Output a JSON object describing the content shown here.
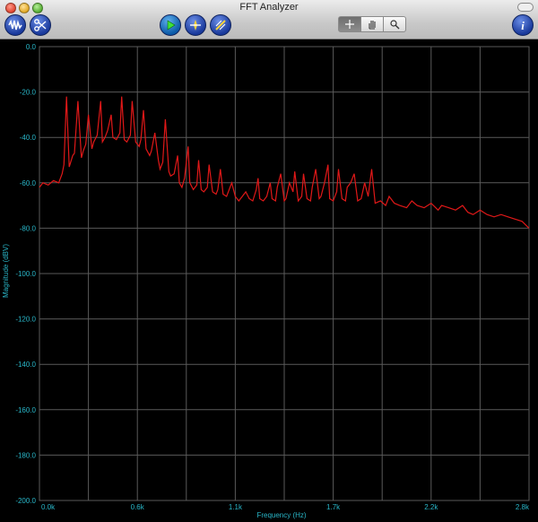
{
  "window": {
    "title": "FFT Analyzer"
  },
  "toolbar": {
    "icons": [
      "waveform-icon",
      "scissors-icon",
      "play-icon",
      "crosshair-target-icon",
      "sweep-icon",
      "info-icon"
    ],
    "tools": [
      "crosshair-icon",
      "hand-icon",
      "zoom-icon"
    ],
    "accent": "#1a3a9c"
  },
  "chart_data": {
    "type": "line",
    "xlabel": "Frequency (Hz)",
    "ylabel": "Magnitude (dBV)",
    "xlim": [
      0,
      2.8
    ],
    "ylim": [
      -200,
      0
    ],
    "x_tick_labels": [
      "0.0k",
      "0.6k",
      "1.1k",
      "1.7k",
      "2.2k",
      "2.8k"
    ],
    "y_tick_labels": [
      "0.0",
      "-20.0",
      "-40.0",
      "-60.0",
      "-80.0",
      "-100.0",
      "-120.0",
      "-140.0",
      "-160.0",
      "-180.0",
      "-200.0"
    ],
    "x_ticks": [
      0,
      0.56,
      1.12,
      1.68,
      2.24,
      2.8
    ],
    "y_ticks": [
      0,
      -20,
      -40,
      -60,
      -80,
      -100,
      -120,
      -140,
      -160,
      -180,
      -200
    ],
    "grid": true,
    "line_color": "#e01818",
    "grid_color": "#5a5a5a",
    "series": [
      {
        "x": [
          0.0,
          0.02,
          0.05,
          0.08,
          0.11,
          0.13,
          0.14,
          0.155,
          0.17,
          0.19,
          0.2,
          0.22,
          0.24,
          0.25,
          0.265,
          0.28,
          0.3,
          0.31,
          0.33,
          0.35,
          0.36,
          0.375,
          0.39,
          0.41,
          0.42,
          0.44,
          0.46,
          0.47,
          0.485,
          0.5,
          0.52,
          0.53,
          0.55,
          0.57,
          0.58,
          0.595,
          0.61,
          0.63,
          0.64,
          0.66,
          0.68,
          0.69,
          0.705,
          0.72,
          0.74,
          0.75,
          0.77,
          0.79,
          0.8,
          0.815,
          0.83,
          0.85,
          0.86,
          0.88,
          0.9,
          0.91,
          0.925,
          0.94,
          0.96,
          0.97,
          0.99,
          1.01,
          1.02,
          1.035,
          1.05,
          1.07,
          1.08,
          1.1,
          1.12,
          1.14,
          1.16,
          1.18,
          1.2,
          1.22,
          1.24,
          1.25,
          1.26,
          1.28,
          1.3,
          1.32,
          1.33,
          1.35,
          1.36,
          1.38,
          1.4,
          1.41,
          1.43,
          1.45,
          1.46,
          1.48,
          1.5,
          1.51,
          1.53,
          1.55,
          1.56,
          1.58,
          1.6,
          1.61,
          1.63,
          1.65,
          1.66,
          1.68,
          1.7,
          1.71,
          1.73,
          1.75,
          1.76,
          1.78,
          1.8,
          1.82,
          1.84,
          1.86,
          1.88,
          1.9,
          1.92,
          1.95,
          1.98,
          2.0,
          2.03,
          2.06,
          2.1,
          2.13,
          2.16,
          2.2,
          2.24,
          2.28,
          2.3,
          2.34,
          2.38,
          2.42,
          2.45,
          2.48,
          2.52,
          2.56,
          2.6,
          2.64,
          2.68,
          2.72,
          2.76,
          2.8
        ],
        "y": [
          -62,
          -60,
          -61,
          -59,
          -60,
          -56,
          -52,
          -22,
          -53,
          -48,
          -47,
          -24,
          -49,
          -46,
          -43,
          -30,
          -45,
          -42,
          -39,
          -24,
          -42,
          -40,
          -37,
          -30,
          -40,
          -41,
          -38,
          -22,
          -41,
          -42,
          -39,
          -24,
          -42,
          -44,
          -41,
          -28,
          -45,
          -48,
          -46,
          -38,
          -50,
          -54,
          -51,
          -32,
          -55,
          -57,
          -56,
          -48,
          -60,
          -62,
          -58,
          -44,
          -60,
          -63,
          -61,
          -50,
          -63,
          -64,
          -62,
          -52,
          -64,
          -65,
          -63,
          -54,
          -65,
          -66,
          -64,
          -60,
          -66,
          -68,
          -66,
          -64,
          -67,
          -68,
          -63,
          -58,
          -67,
          -68,
          -66,
          -60,
          -67,
          -68,
          -62,
          -56,
          -68,
          -67,
          -60,
          -64,
          -55,
          -68,
          -66,
          -56,
          -67,
          -68,
          -62,
          -54,
          -67,
          -66,
          -60,
          -52,
          -67,
          -68,
          -64,
          -54,
          -67,
          -68,
          -62,
          -60,
          -56,
          -68,
          -67,
          -60,
          -66,
          -54,
          -69,
          -68,
          -70,
          -66,
          -69,
          -70,
          -71,
          -68,
          -70,
          -71,
          -69,
          -72,
          -70,
          -71,
          -72,
          -70,
          -73,
          -74,
          -72,
          -74,
          -75,
          -74,
          -75,
          -76,
          -77,
          -80
        ]
      }
    ]
  }
}
